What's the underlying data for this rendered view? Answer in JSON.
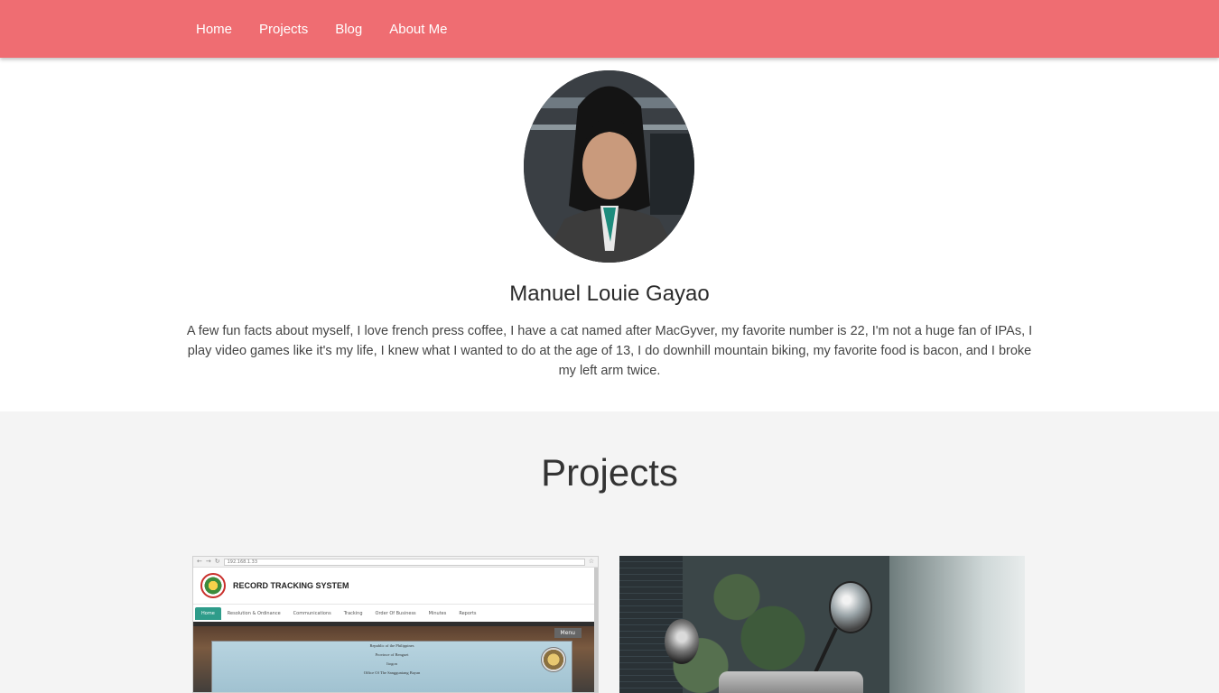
{
  "nav": {
    "items": [
      "Home",
      "Projects",
      "Blog",
      "About Me"
    ],
    "color": "#ef6d72"
  },
  "profile": {
    "name": "Manuel Louie Gayao",
    "bio": "A few fun facts about myself, I love french press coffee, I have a cat named after MacGyver, my favorite number is 22, I'm not a huge fan of IPAs, I play video games like it's my life, I knew what I wanted to do at the age of 13, I do downhill mountain biking, my favorite food is bacon, and I broke my left arm twice."
  },
  "projects": {
    "title": "Projects",
    "cards": [
      {
        "screenshot": {
          "url": "192.168.1.33",
          "site_title": "RECORD TRACKING SYSTEM",
          "tabs": [
            "Home",
            "Resolution & Ordinance",
            "Communications",
            "Tracking",
            "Order Of Business",
            "Minutes",
            "Reports"
          ],
          "menu_label": "Menu",
          "doc_lines": [
            "Republic of the Philippines",
            "Province of Benguet",
            "Itogon",
            "Office Of The Sangguniang Bayan"
          ]
        }
      },
      {
        "photo": "scooter-mirror-photo"
      }
    ]
  }
}
